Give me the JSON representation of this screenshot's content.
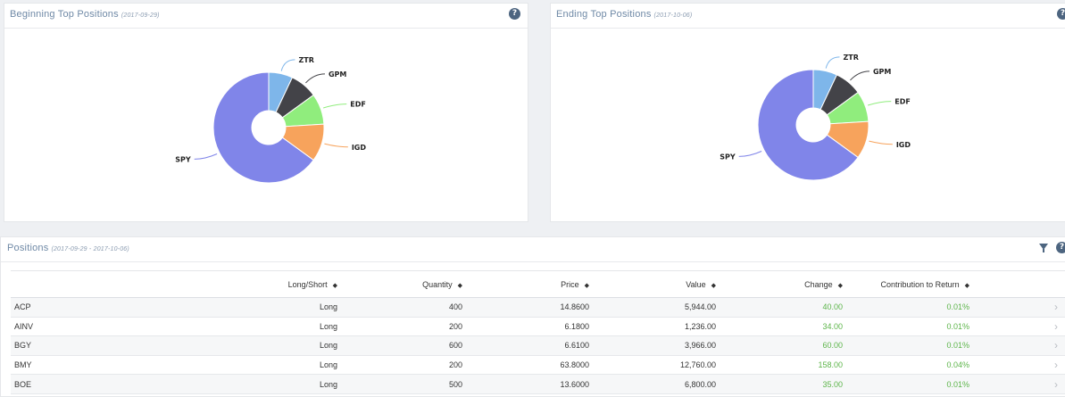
{
  "beginning_panel": {
    "title": "Beginning Top Positions",
    "date": "(2017-09-29)"
  },
  "ending_panel": {
    "title": "Ending Top Positions",
    "date": "(2017-10-06)"
  },
  "positions_panel": {
    "title": "Positions",
    "date_range": "(2017-09-29 - 2017-10-06)"
  },
  "icons": {
    "help": "question-circle-icon",
    "filter": "filter-icon",
    "row_chevron": "chevron-right-icon"
  },
  "colors": {
    "ZTR": "#7eb6ea",
    "GPM": "#434348",
    "EDF": "#90ed7d",
    "IGD": "#f7a35c",
    "SPY": "#8085e9",
    "positive": "#5db54a",
    "title": "#6f89a6"
  },
  "chart_data": [
    {
      "type": "pie",
      "title": "Beginning Top Positions",
      "donut": true,
      "categories": [
        "ZTR",
        "GPM",
        "EDF",
        "IGD",
        "SPY"
      ],
      "values": [
        7,
        8,
        9,
        11,
        65
      ]
    },
    {
      "type": "pie",
      "title": "Ending Top Positions",
      "donut": true,
      "categories": [
        "ZTR",
        "GPM",
        "EDF",
        "IGD",
        "SPY"
      ],
      "values": [
        7,
        8,
        9,
        11,
        65
      ]
    }
  ],
  "table": {
    "headers": {
      "long_short": "Long/Short",
      "quantity": "Quantity",
      "price": "Price",
      "value": "Value",
      "change": "Change",
      "contribution": "Contribution to Return"
    },
    "sort_glyph": "◆",
    "chevron_glyph": "›",
    "rows": [
      {
        "symbol": "ACP",
        "long_short": "Long",
        "quantity": "400",
        "price": "14.8600",
        "value": "5,944.00",
        "change": "40.00",
        "contribution": "0.01%"
      },
      {
        "symbol": "AINV",
        "long_short": "Long",
        "quantity": "200",
        "price": "6.1800",
        "value": "1,236.00",
        "change": "34.00",
        "contribution": "0.01%"
      },
      {
        "symbol": "BGY",
        "long_short": "Long",
        "quantity": "600",
        "price": "6.6100",
        "value": "3,966.00",
        "change": "60.00",
        "contribution": "0.01%"
      },
      {
        "symbol": "BMY",
        "long_short": "Long",
        "quantity": "200",
        "price": "63.8000",
        "value": "12,760.00",
        "change": "158.00",
        "contribution": "0.04%"
      },
      {
        "symbol": "BOE",
        "long_short": "Long",
        "quantity": "500",
        "price": "13.6000",
        "value": "6,800.00",
        "change": "35.00",
        "contribution": "0.01%"
      }
    ]
  }
}
